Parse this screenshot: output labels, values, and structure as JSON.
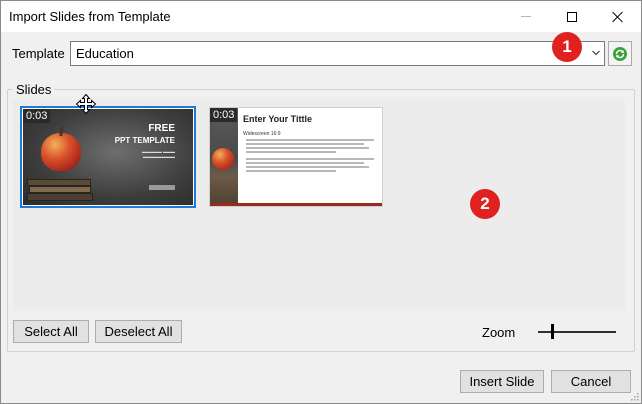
{
  "window": {
    "title": "Import Slides from Template"
  },
  "template": {
    "label": "Template",
    "value": "Education"
  },
  "slides_group": {
    "label": "Slides",
    "thumbnails": [
      {
        "duration": "0:03",
        "heading": "FREE",
        "subheading": "PPT TEMPLATE",
        "selected": true
      },
      {
        "duration": "0:03",
        "heading": "Enter Your Tittle",
        "subheading": "Widescreen 16:9",
        "selected": false
      }
    ]
  },
  "buttons": {
    "select_all": "Select All",
    "deselect_all": "Deselect All",
    "insert_slide": "Insert Slide",
    "cancel": "Cancel"
  },
  "zoom": {
    "label": "Zoom",
    "level": 0.18
  },
  "annotations": {
    "badge1": "1",
    "badge2": "2"
  },
  "colors": {
    "accent": "#1e7ad6",
    "badge": "#e12020",
    "refresh_icon": "#3aa23a"
  },
  "icons": [
    "minimize-icon",
    "maximize-icon",
    "close-icon",
    "chevron-down-icon",
    "refresh-icon",
    "move-cursor-icon"
  ]
}
